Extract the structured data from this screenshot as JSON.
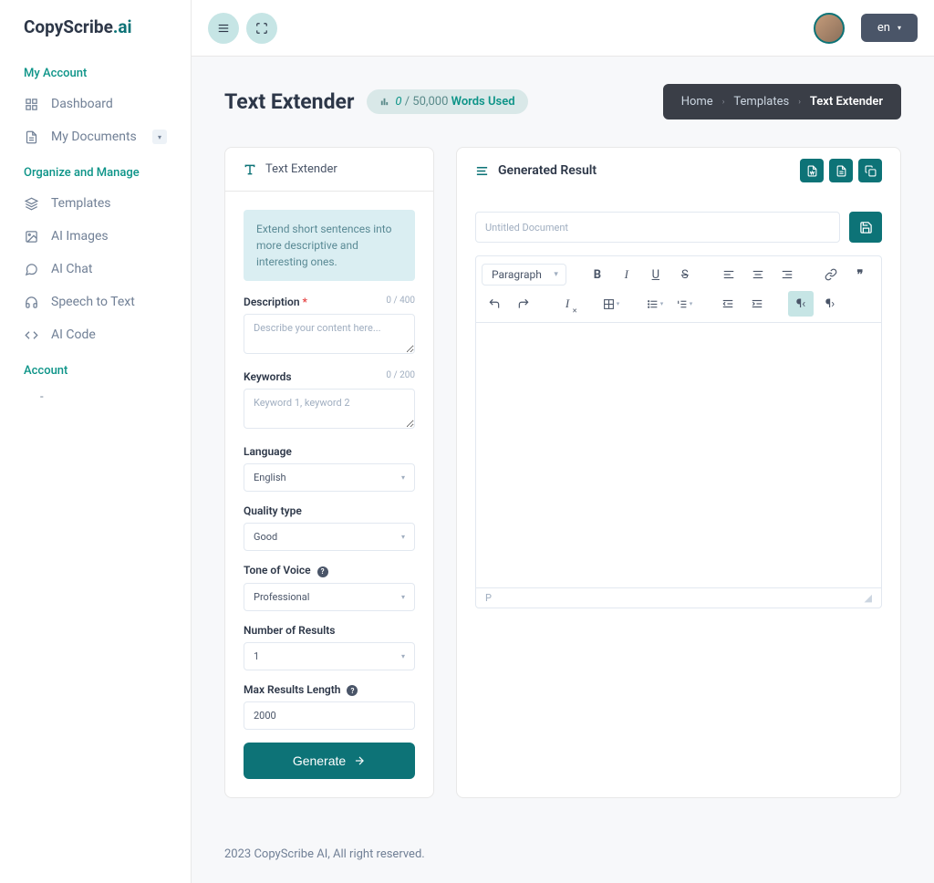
{
  "logo": {
    "brand": "CopyScribe",
    "suffix": ".ai"
  },
  "topbar": {
    "lang_label": "en"
  },
  "nav": {
    "section1_title": "My Account",
    "section2_title": "Organize and Manage",
    "section3_title": "Account",
    "items1": [
      {
        "label": "Dashboard"
      },
      {
        "label": "My Documents"
      }
    ],
    "items2": [
      {
        "label": "Templates"
      },
      {
        "label": "AI Images"
      },
      {
        "label": "AI Chat"
      },
      {
        "label": "Speech to Text"
      },
      {
        "label": "AI Code"
      }
    ],
    "acc_item": "-"
  },
  "page": {
    "title": "Text Extender",
    "usage_count": "0",
    "usage_sep": " / 50,000 ",
    "usage_label": "Words Used"
  },
  "breadcrumb": {
    "home": "Home",
    "templates": "Templates",
    "current": "Text Extender"
  },
  "left_panel": {
    "title": "Text Extender",
    "info": "Extend short sentences into more descriptive and interesting ones.",
    "desc_label": "Description",
    "desc_count": "0 / 400",
    "desc_placeholder": "Describe your content here...",
    "kw_label": "Keywords",
    "kw_count": "0 / 200",
    "kw_placeholder": "Keyword 1, keyword 2",
    "lang_label": "Language",
    "lang_value": "English",
    "quality_label": "Quality type",
    "quality_value": "Good",
    "tone_label": "Tone of Voice",
    "tone_value": "Professional",
    "num_label": "Number of Results",
    "num_value": "1",
    "max_label": "Max Results Length",
    "max_value": "2000",
    "generate": "Generate"
  },
  "right_panel": {
    "title": "Generated Result",
    "doc_placeholder": "Untitled Document",
    "paragraph_label": "Paragraph",
    "path_indicator": "P"
  },
  "footer": {
    "text": "2023 CopyScribe AI, All right reserved."
  }
}
